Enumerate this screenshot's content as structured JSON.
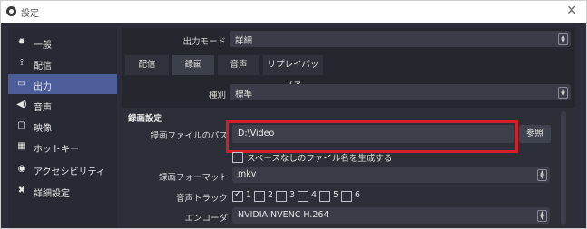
{
  "window": {
    "title": "設定",
    "close_icon": "close-icon"
  },
  "sidebar": {
    "items": [
      {
        "label": "一般",
        "icon": "gear-icon",
        "active": false
      },
      {
        "label": "配信",
        "icon": "antenna-icon",
        "active": false
      },
      {
        "label": "出力",
        "icon": "output-icon",
        "active": true
      },
      {
        "label": "音声",
        "icon": "speaker-icon",
        "active": false
      },
      {
        "label": "映像",
        "icon": "monitor-icon",
        "active": false
      },
      {
        "label": "ホットキー",
        "icon": "keyboard-icon",
        "active": false
      },
      {
        "label": "アクセシビリティ",
        "icon": "accessibility-icon",
        "active": false
      },
      {
        "label": "詳細設定",
        "icon": "tools-icon",
        "active": false
      }
    ]
  },
  "output_mode": {
    "label": "出力モード",
    "value": "詳細"
  },
  "tabs": [
    {
      "label": "配信",
      "active": false
    },
    {
      "label": "録画",
      "active": true
    },
    {
      "label": "音声",
      "active": false
    },
    {
      "label": "リプレイバッファ",
      "active": false
    }
  ],
  "type": {
    "label": "種別",
    "value": "標準"
  },
  "recording": {
    "section_title": "録画設定",
    "path_label": "録画ファイルのパス",
    "path_value": "D:\\Video",
    "browse_label": "参照",
    "no_space_label": "スペースなしのファイル名を生成する",
    "format_label": "録画フォーマット",
    "format_value": "mkv",
    "tracks_label": "音声トラック",
    "tracks": [
      "1",
      "2",
      "3",
      "4",
      "5",
      "6"
    ],
    "tracks_checked": [
      true,
      false,
      false,
      false,
      false,
      false
    ],
    "encoder_label": "エンコーダ",
    "encoder_value": "NVIDIA NVENC H.264"
  },
  "colors": {
    "highlight": "#d21f2a",
    "active_sidebar": "#4c5d9a"
  }
}
